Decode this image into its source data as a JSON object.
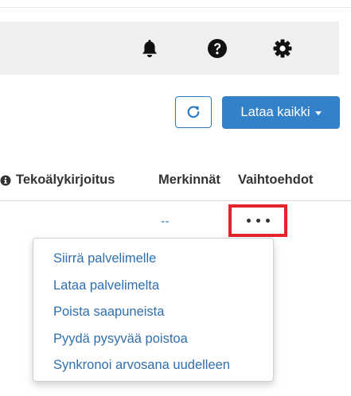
{
  "header": {
    "icons": [
      "bell-icon",
      "help-icon",
      "gear-icon"
    ]
  },
  "toolbar": {
    "refresh_icon": "refresh-icon",
    "load_all_label": "Lataa kaikki"
  },
  "table": {
    "columns": {
      "ai_writing": "Tekoälykirjoitus",
      "marks": "Merkinnät",
      "options": "Vaihtoehdot"
    },
    "row": {
      "marks_value": "--"
    }
  },
  "options_menu": {
    "items": [
      "Siirrä palvelimelle",
      "Lataa palvelimelta",
      "Poista saapuneista",
      "Pyydä pysyvää poistoa",
      "Synkronoi arvosana uudelleen"
    ]
  },
  "colors": {
    "primary": "#3381c9",
    "link": "#2f6fad",
    "highlight": "#e5232a"
  }
}
